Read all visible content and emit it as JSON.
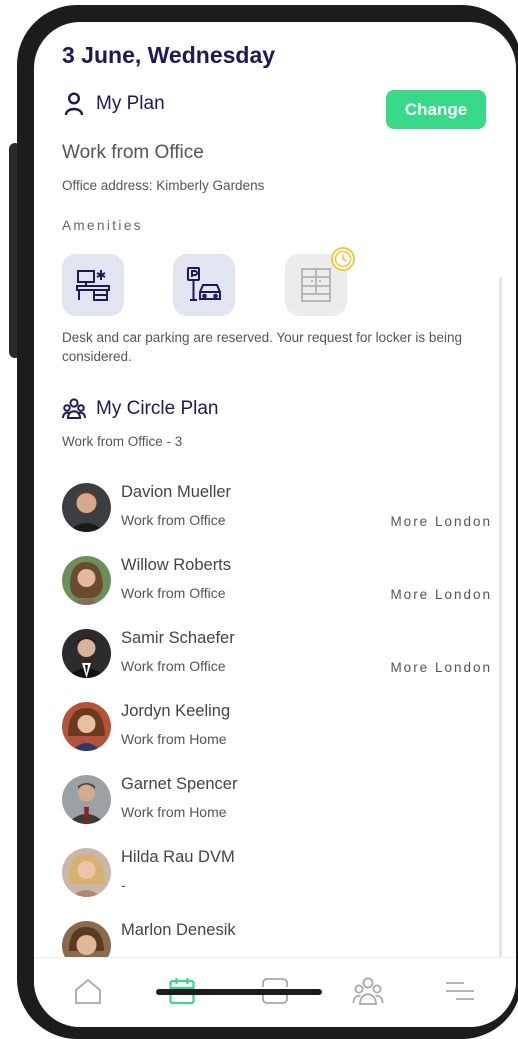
{
  "header": {
    "date": "3 June, Wednesday"
  },
  "my_plan": {
    "title": "My Plan",
    "change_label": "Change",
    "plan_type": "Work from Office",
    "office_address": "Office address: Kimberly Gardens",
    "amenities_label": "Amenities",
    "amenities": [
      {
        "icon": "desk-icon",
        "status": "reserved"
      },
      {
        "icon": "car-parking-icon",
        "status": "reserved"
      },
      {
        "icon": "locker-icon",
        "status": "pending"
      }
    ],
    "amenities_note": "Desk and car parking are reserved. Your request for locker is being considered."
  },
  "circle_plan": {
    "title": "My Circle Plan",
    "subtitle": "Work from Office - 3",
    "members": [
      {
        "name": "Davion Mueller",
        "status": "Work from Office",
        "location": "More London"
      },
      {
        "name": "Willow Roberts",
        "status": "Work from Office",
        "location": "More London"
      },
      {
        "name": "Samir Schaefer",
        "status": "Work from Office",
        "location": "More London"
      },
      {
        "name": "Jordyn Keeling",
        "status": "Work from Home",
        "location": ""
      },
      {
        "name": "Garnet Spencer",
        "status": "Work from Home",
        "location": ""
      },
      {
        "name": "Hilda Rau DVM",
        "status": "-",
        "location": ""
      },
      {
        "name": "Marlon Denesik",
        "status": "",
        "location": ""
      }
    ]
  },
  "tabbar": {
    "tabs": [
      {
        "icon": "home-icon",
        "active": false
      },
      {
        "icon": "calendar-icon",
        "active": true
      },
      {
        "icon": "scan-icon",
        "active": false
      },
      {
        "icon": "people-icon",
        "active": false
      },
      {
        "icon": "menu-icon",
        "active": false
      }
    ]
  },
  "colors": {
    "accent": "#39d98a",
    "title": "#1b1a55",
    "pending": "#f6c744"
  }
}
